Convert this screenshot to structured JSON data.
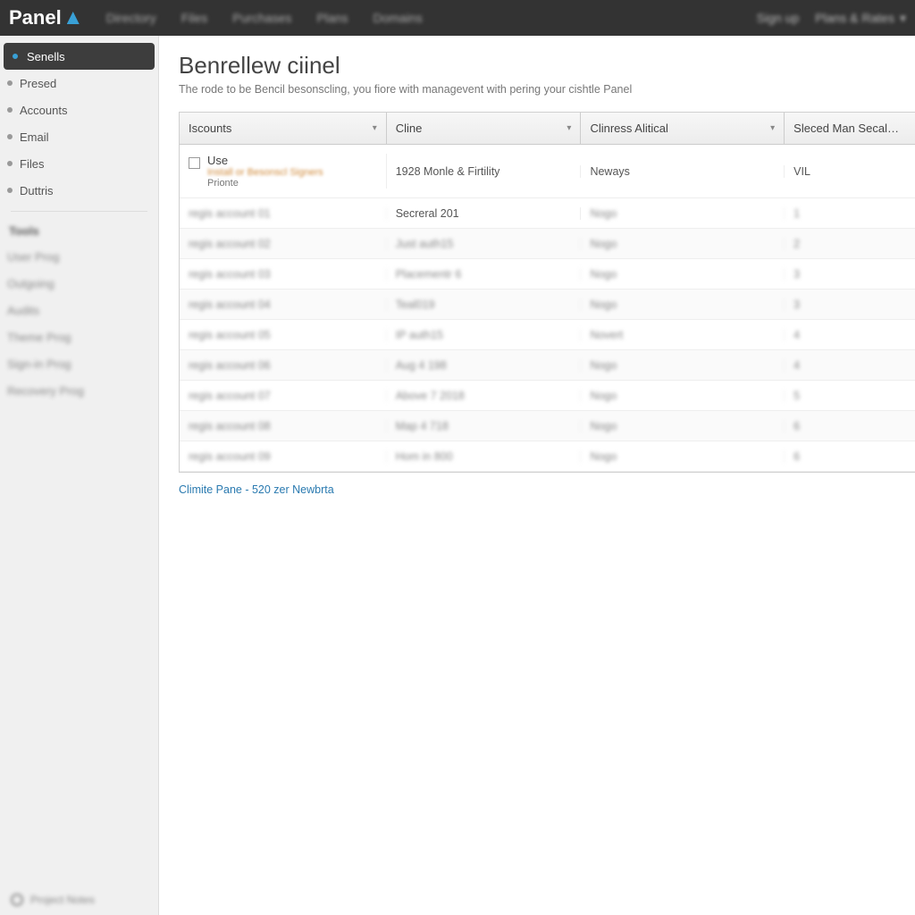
{
  "brand": {
    "name": "Panel"
  },
  "topnav": {
    "links": [
      "Directory",
      "Files",
      "Purchases",
      "Plans",
      "Domains"
    ],
    "right": [
      "Sign up",
      "Plans & Rates"
    ]
  },
  "sidebar": {
    "primary": [
      {
        "label": "Senells",
        "active": true
      },
      {
        "label": "Presed"
      },
      {
        "label": "Accounts"
      },
      {
        "label": "Email"
      },
      {
        "label": "Files"
      },
      {
        "label": "Duttris"
      }
    ],
    "secondary_header": "Tools",
    "secondary": [
      "User Prog",
      "Outgoing",
      "Audits",
      "Theme Prog",
      "Sign-in Prog",
      "Recovery Prog"
    ],
    "footer": "Project Notes"
  },
  "page": {
    "title": "Benrellew ciinel",
    "subtitle": "The rode to be Bencil besonscling, you fiore with managevent with pering your cishtle Panel"
  },
  "table": {
    "headers": [
      "Iscounts",
      "Cline",
      "Clinress Alitical",
      "Sleced Man Secal…"
    ],
    "rows": [
      {
        "c1_lead": "Use",
        "c1_sub1": "Install or Besonscl Signers",
        "c1_sub2": "Prionte",
        "c2": "1928 Monle & Firtility",
        "c3": "Neways",
        "c4": "VIL"
      },
      {
        "c1": "regis account 01",
        "c2": "Secreral 201",
        "c3": "Nogo",
        "c4": "1"
      },
      {
        "c1": "regis account 02",
        "c2": "Just auth15",
        "c3": "Nogo",
        "c4": "2"
      },
      {
        "c1": "regis account 03",
        "c2": "Placementr 6",
        "c3": "Nogo",
        "c4": "3"
      },
      {
        "c1": "regis account 04",
        "c2": "Teal019",
        "c3": "Nogo",
        "c4": "3"
      },
      {
        "c1": "regis account 05",
        "c2": "IP auth15",
        "c3": "Novert",
        "c4": "4"
      },
      {
        "c1": "regis account 06",
        "c2": "Aug 4 198",
        "c3": "Nogo",
        "c4": "4"
      },
      {
        "c1": "regis account 07",
        "c2": "Above 7 2018",
        "c3": "Nogo",
        "c4": "5"
      },
      {
        "c1": "regis account 08",
        "c2": "Map 4 718",
        "c3": "Nogo",
        "c4": "6"
      },
      {
        "c1": "regis account 09",
        "c2": "Hom in 800",
        "c3": "Nogo",
        "c4": "6"
      }
    ]
  },
  "footlink": "Climite Pane - 520 zer Newbrta"
}
